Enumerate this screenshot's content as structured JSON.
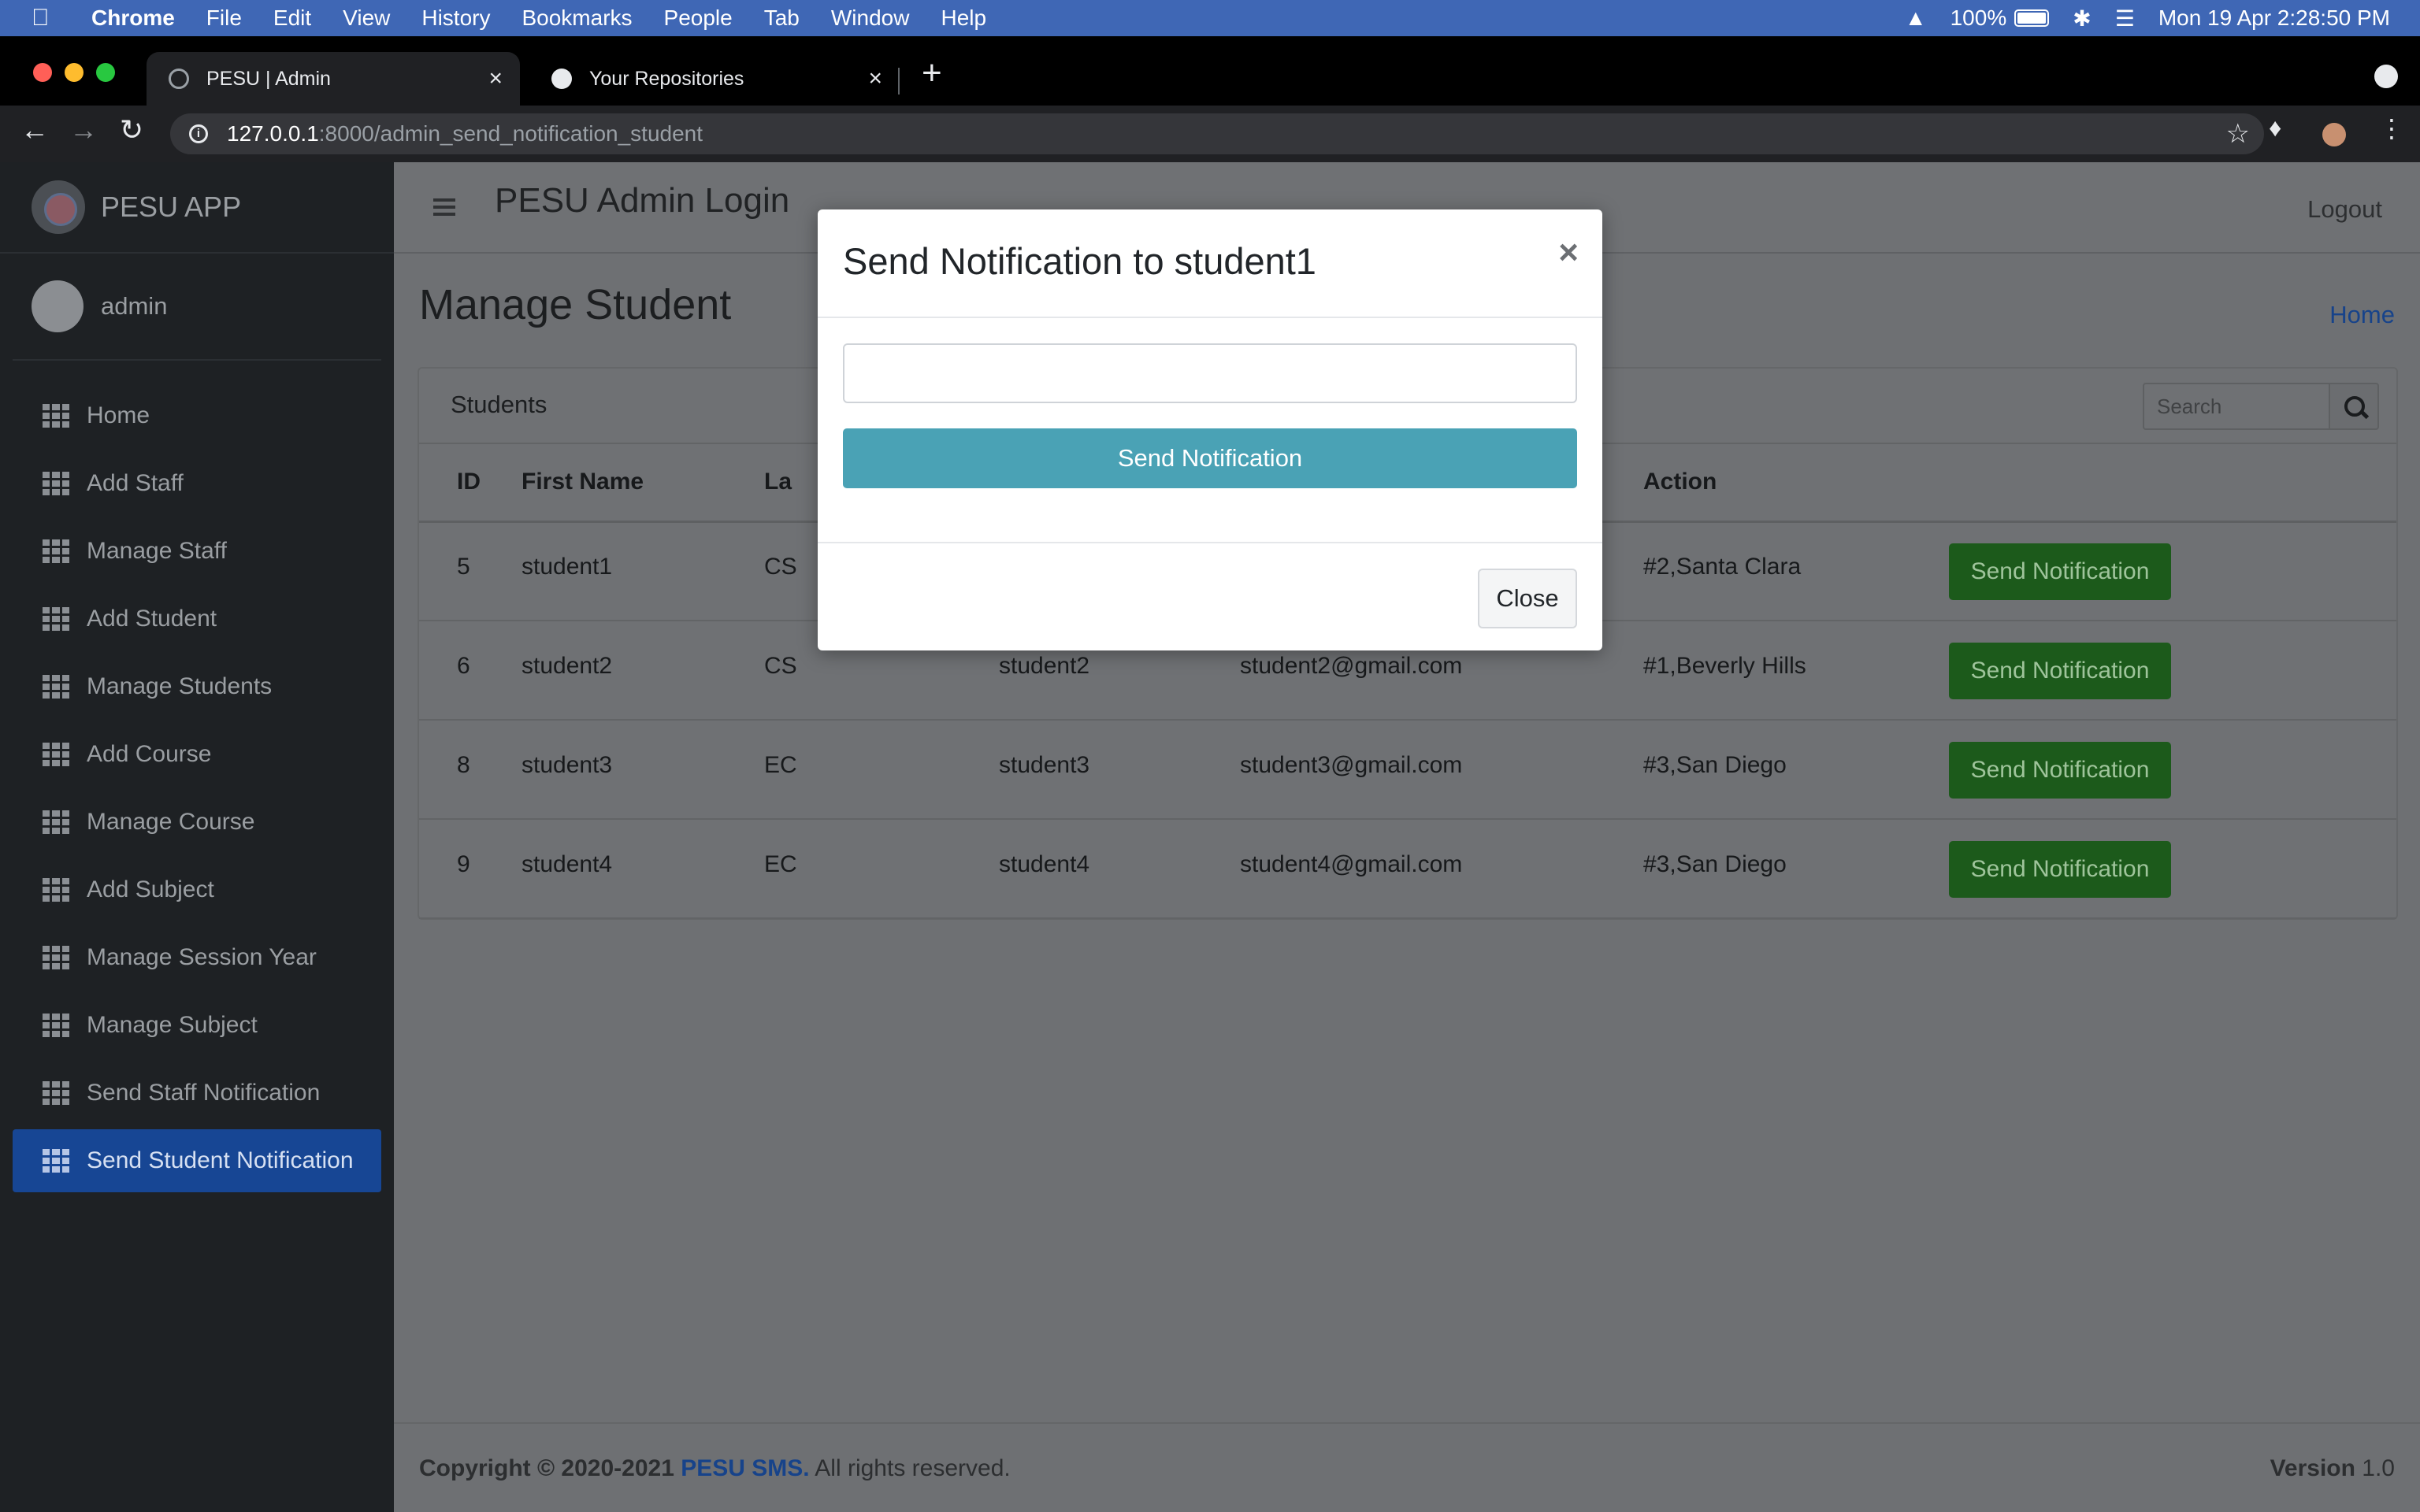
{
  "menubar": {
    "app_name": "Chrome",
    "items": [
      "File",
      "Edit",
      "View",
      "History",
      "Bookmarks",
      "People",
      "Tab",
      "Window",
      "Help"
    ],
    "battery": "100%",
    "clock": "Mon 19 Apr  2:28:50 PM"
  },
  "browser": {
    "tabs": [
      {
        "title": "PESU | Admin",
        "active": true
      },
      {
        "title": "Your Repositories",
        "active": false
      }
    ],
    "url_host": "127.0.0.1",
    "url_path": ":8000/admin_send_notification_student"
  },
  "sidebar": {
    "brand": "PESU APP",
    "user": "admin",
    "items": [
      {
        "label": "Home"
      },
      {
        "label": "Add Staff"
      },
      {
        "label": "Manage Staff"
      },
      {
        "label": "Add Student"
      },
      {
        "label": "Manage Students"
      },
      {
        "label": "Add Course"
      },
      {
        "label": "Manage Course"
      },
      {
        "label": "Add Subject"
      },
      {
        "label": "Manage Session Year"
      },
      {
        "label": "Manage Subject"
      },
      {
        "label": "Send Staff Notification"
      },
      {
        "label": "Send Student Notification",
        "active": true
      }
    ]
  },
  "header": {
    "title": "PESU Admin Login",
    "logout": "Logout"
  },
  "page": {
    "title": "Manage Student",
    "breadcrumb": "Home"
  },
  "card": {
    "title": "Students",
    "search_placeholder": "Search"
  },
  "table": {
    "columns": [
      "ID",
      "First Name",
      "La",
      "",
      "",
      "Action",
      ""
    ],
    "rows": [
      {
        "id": "5",
        "first": "student1",
        "course": "CS",
        "last": "",
        "email": "",
        "address": "#2,Santa Clara",
        "action": "Send Notification"
      },
      {
        "id": "6",
        "first": "student2",
        "course": "CS",
        "last": "student2",
        "email": "student2@gmail.com",
        "address": "#1,Beverly Hills",
        "action": "Send Notification"
      },
      {
        "id": "8",
        "first": "student3",
        "course": "EC",
        "last": "student3",
        "email": "student3@gmail.com",
        "address": "#3,San Diego",
        "action": "Send Notification"
      },
      {
        "id": "9",
        "first": "student4",
        "course": "EC",
        "last": "student4",
        "email": "student4@gmail.com",
        "address": "#3,San Diego",
        "action": "Send Notification"
      }
    ]
  },
  "footer": {
    "copyright": "Copyright © 2020-2021 ",
    "brand": "PESU SMS.",
    "rights": " All rights reserved.",
    "version_label": "Version",
    "version": " 1.0"
  },
  "modal": {
    "title": "Send Notification to student1",
    "close_icon": "×",
    "input_value": "",
    "send_label": "Send Notification",
    "close_label": "Close"
  },
  "colors": {
    "menubar": "#3f67b5",
    "sidebar": "#1e2124",
    "sidebar_active": "#174694",
    "action_button": "#1c5a1b",
    "modal_send": "#4aa2b5",
    "link": "#17438a"
  }
}
